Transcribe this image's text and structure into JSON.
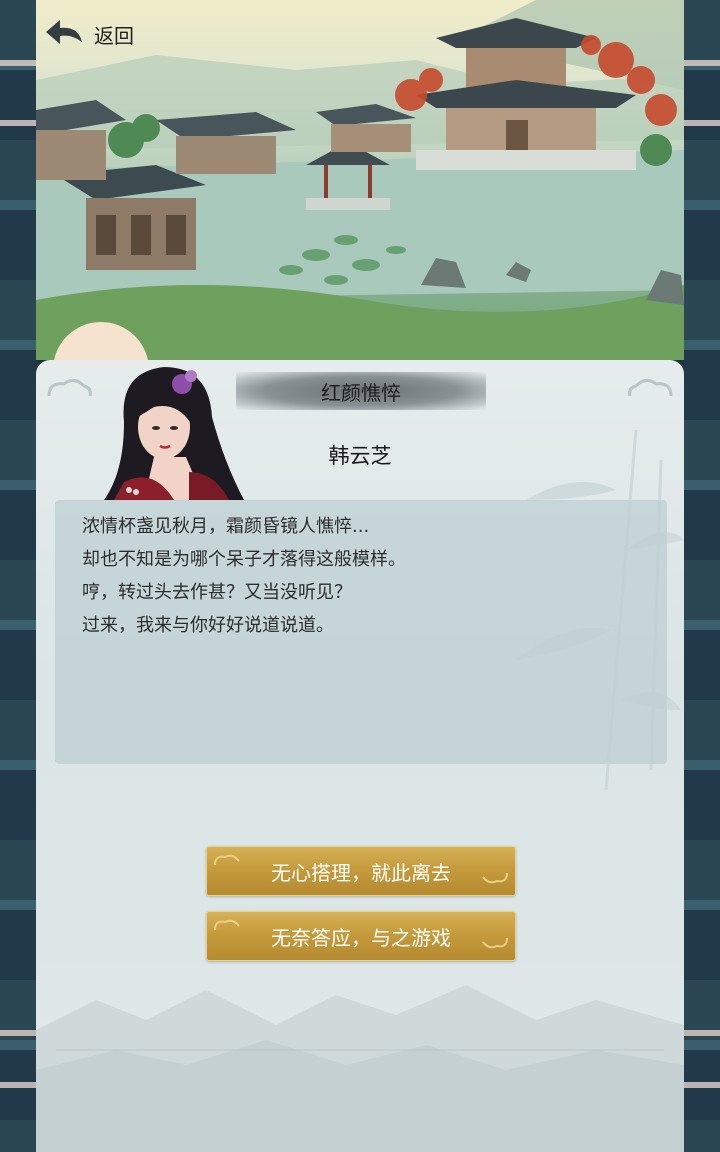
{
  "nav": {
    "back_label": "返回"
  },
  "event": {
    "title": "红颜憔悴",
    "character_name": "韩云芝",
    "dialog_lines": [
      "浓情杯盏见秋月，霜颜昏镜人憔悴...",
      "却也不知是为哪个呆子才落得这般模样。",
      "哼，转过头去作甚？又当没听见？",
      "过来，我来与你好好说道说道。"
    ]
  },
  "choices": [
    {
      "label": "无心搭理，就此离去"
    },
    {
      "label": "无奈答应，与之游戏"
    }
  ],
  "colors": {
    "button_gold": "#c59b3c",
    "panel_bg": "#dde6e7",
    "border_dark": "#2b4753"
  }
}
